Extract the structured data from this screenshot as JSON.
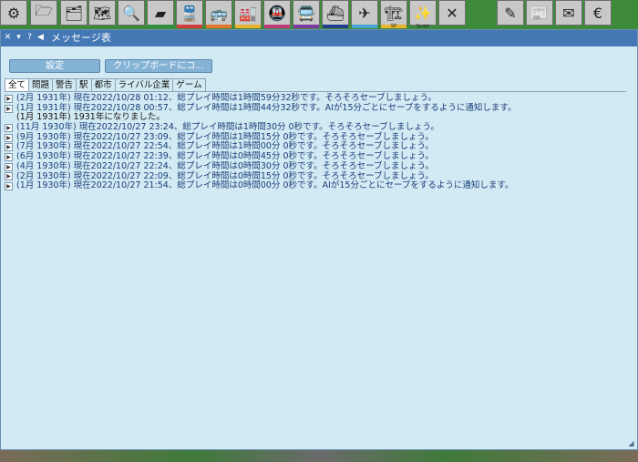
{
  "toolbar": {
    "items": [
      {
        "icon": "gear-icon",
        "glyph": "⚙",
        "label": "",
        "strip": ""
      },
      {
        "icon": "folder-download-icon",
        "glyph": "🗁",
        "label": "",
        "strip": ""
      },
      {
        "icon": "folder-upload-icon",
        "glyph": "🗂",
        "label": "",
        "strip": ""
      },
      {
        "icon": "world-map-icon",
        "glyph": "🗺",
        "label": "",
        "strip": ""
      },
      {
        "icon": "zoom-icon",
        "glyph": "🔍",
        "label": "",
        "strip": ""
      },
      {
        "icon": "terraform-icon",
        "glyph": "▰",
        "label": "",
        "strip": "#2f8f3a"
      },
      {
        "icon": "train-icon",
        "glyph": "🚆",
        "label": "",
        "strip": "#d33d3d"
      },
      {
        "icon": "road-vehicle-icon",
        "glyph": "🚌",
        "label": "",
        "strip": "#e0762b"
      },
      {
        "icon": "industry-icon",
        "glyph": "🏭",
        "label": "",
        "strip": "#e8b430"
      },
      {
        "icon": "train-list-icon",
        "glyph": "🚇",
        "label": "",
        "strip": "#c03a7e"
      },
      {
        "icon": "bus-list-icon",
        "glyph": "🚍",
        "label": "",
        "strip": "#7a3aa0"
      },
      {
        "icon": "ship-icon",
        "glyph": "⛴",
        "label": "",
        "strip": "#1f3d8a"
      },
      {
        "icon": "airplane-icon",
        "glyph": "✈",
        "label": "",
        "strip": "#4aa5d8"
      },
      {
        "icon": "crane-icon",
        "glyph": "🏗",
        "label": "SP",
        "strip": "#e8b430"
      },
      {
        "icon": "script-magic-icon",
        "glyph": "✨",
        "label": "Script",
        "strip": ""
      },
      {
        "icon": "close-x-icon",
        "glyph": "✕",
        "label": "",
        "strip": ""
      },
      {
        "icon": "landscape-tool-icon",
        "glyph": "✎",
        "label": "",
        "strip": ""
      },
      {
        "icon": "news-icon",
        "glyph": "📰",
        "label": "",
        "strip": ""
      },
      {
        "icon": "mail-icon",
        "glyph": "✉",
        "label": "",
        "strip": ""
      },
      {
        "icon": "euro-finance-icon",
        "glyph": "€",
        "label": "",
        "strip": ""
      }
    ]
  },
  "window": {
    "title": "メッセージ表",
    "close_glyph": "✕",
    "collapse_glyph": "▾",
    "help_glyph": "?",
    "sound_glyph": "◀",
    "settings_button": "設定",
    "clipboard_button": "クリップボードにコ..."
  },
  "tabs": [
    "全て",
    "問題",
    "警告",
    "駅",
    "都市",
    "ライバル企業",
    "ゲーム"
  ],
  "messages": [
    {
      "text": "(2月 1931年) 現在2022/10/28 01:12、総プレイ時間は1時間59分32秒です。そろそろセーブしましょう。",
      "arrow": true
    },
    {
      "text": "(1月 1931年) 現在2022/10/28 00:57、総プレイ時間は1時間44分32秒です。AIが15分ごとにセーブをするように通知します。",
      "arrow": true
    },
    {
      "text": "(1月 1931年) 1931年になりました。",
      "arrow": false
    },
    {
      "text": "(11月 1930年) 現在2022/10/27 23:24、総プレイ時間は1時間30分 0秒です。そろそろセーブしましょう。",
      "arrow": true
    },
    {
      "text": "(9月 1930年) 現在2022/10/27 23:09、総プレイ時間は1時間15分 0秒です。そろそろセーブしましょう。",
      "arrow": true
    },
    {
      "text": "(7月 1930年) 現在2022/10/27 22:54、総プレイ時間は1時間00分 0秒です。そろそろセーブしましょう。",
      "arrow": true
    },
    {
      "text": "(6月 1930年) 現在2022/10/27 22:39、総プレイ時間は0時間45分 0秒です。そろそろセーブしましょう。",
      "arrow": true
    },
    {
      "text": "(4月 1930年) 現在2022/10/27 22:24、総プレイ時間は0時間30分 0秒です。そろそろセーブしましょう。",
      "arrow": true
    },
    {
      "text": "(2月 1930年) 現在2022/10/27 22:09、総プレイ時間は0時間15分 0秒です。そろそろセーブしましょう。",
      "arrow": true
    },
    {
      "text": "(1月 1930年) 現在2022/10/27 21:54、総プレイ時間は0時間00分 0秒です。AIが15分ごとにセーブをするように通知します。",
      "arrow": true
    }
  ],
  "colors": {
    "titlebar": "#4478b4",
    "window_bg": "#d2eaf3",
    "message_text": "#1b3d7a"
  }
}
